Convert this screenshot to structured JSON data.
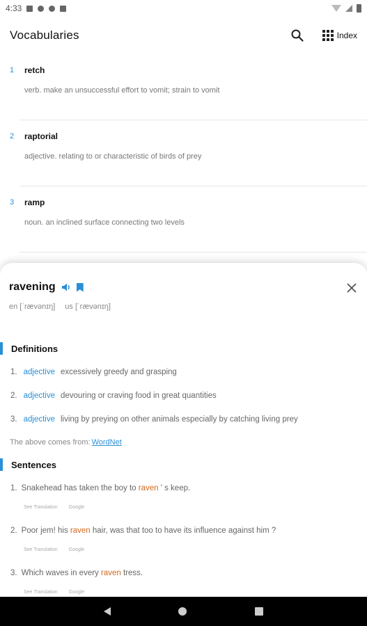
{
  "status_bar": {
    "time": "4:33"
  },
  "app_bar": {
    "title": "Vocabularies",
    "index_label": "Index"
  },
  "vocab_list": [
    {
      "num": "1",
      "word": "retch",
      "definition": "verb. make an unsuccessful effort to vomit; strain to vomit"
    },
    {
      "num": "2",
      "word": "raptorial",
      "definition": "adjective. relating to or characteristic of birds of prey"
    },
    {
      "num": "3",
      "word": "ramp",
      "definition": "noun. an inclined surface connecting two levels"
    }
  ],
  "sheet": {
    "headword": "ravening",
    "phonetic_en": "en [ˈrævənɪŋ]",
    "phonetic_us": "us [ˈrævənɪŋ]",
    "definitions_title": "Definitions",
    "definitions": [
      {
        "num": "1.",
        "pos": "adjective",
        "text": "excessively greedy and grasping"
      },
      {
        "num": "2.",
        "pos": "adjective",
        "text": "devouring or craving food in great quantities"
      },
      {
        "num": "3.",
        "pos": "adjective",
        "text": "living by preying on other animals especially by catching living prey"
      }
    ],
    "source_prefix": "The above comes from:",
    "source_link": "WordNet",
    "sentences_title": "Sentences",
    "sentences": [
      {
        "num": "1.",
        "before": "Snakehead has taken the boy to ",
        "highlight": "raven",
        "after": " ' s keep.",
        "see_translation": "See Translation",
        "google": "Google"
      },
      {
        "num": "2.",
        "before": "Poor jem! his ",
        "highlight": "raven",
        "after": " hair, was that too to have its influence against him ?",
        "see_translation": "See Translation",
        "google": "Google"
      },
      {
        "num": "3.",
        "before": "Which waves in every ",
        "highlight": "raven",
        "after": " tress.",
        "see_translation": "See Translation",
        "google": "Google"
      }
    ]
  },
  "colors": {
    "accent": "#2a8fd6",
    "highlight": "#d2691e"
  },
  "icons": [
    "search-icon",
    "grid-icon",
    "speaker-icon",
    "bookmark-icon",
    "close-icon",
    "back-icon",
    "home-icon",
    "recents-icon"
  ]
}
